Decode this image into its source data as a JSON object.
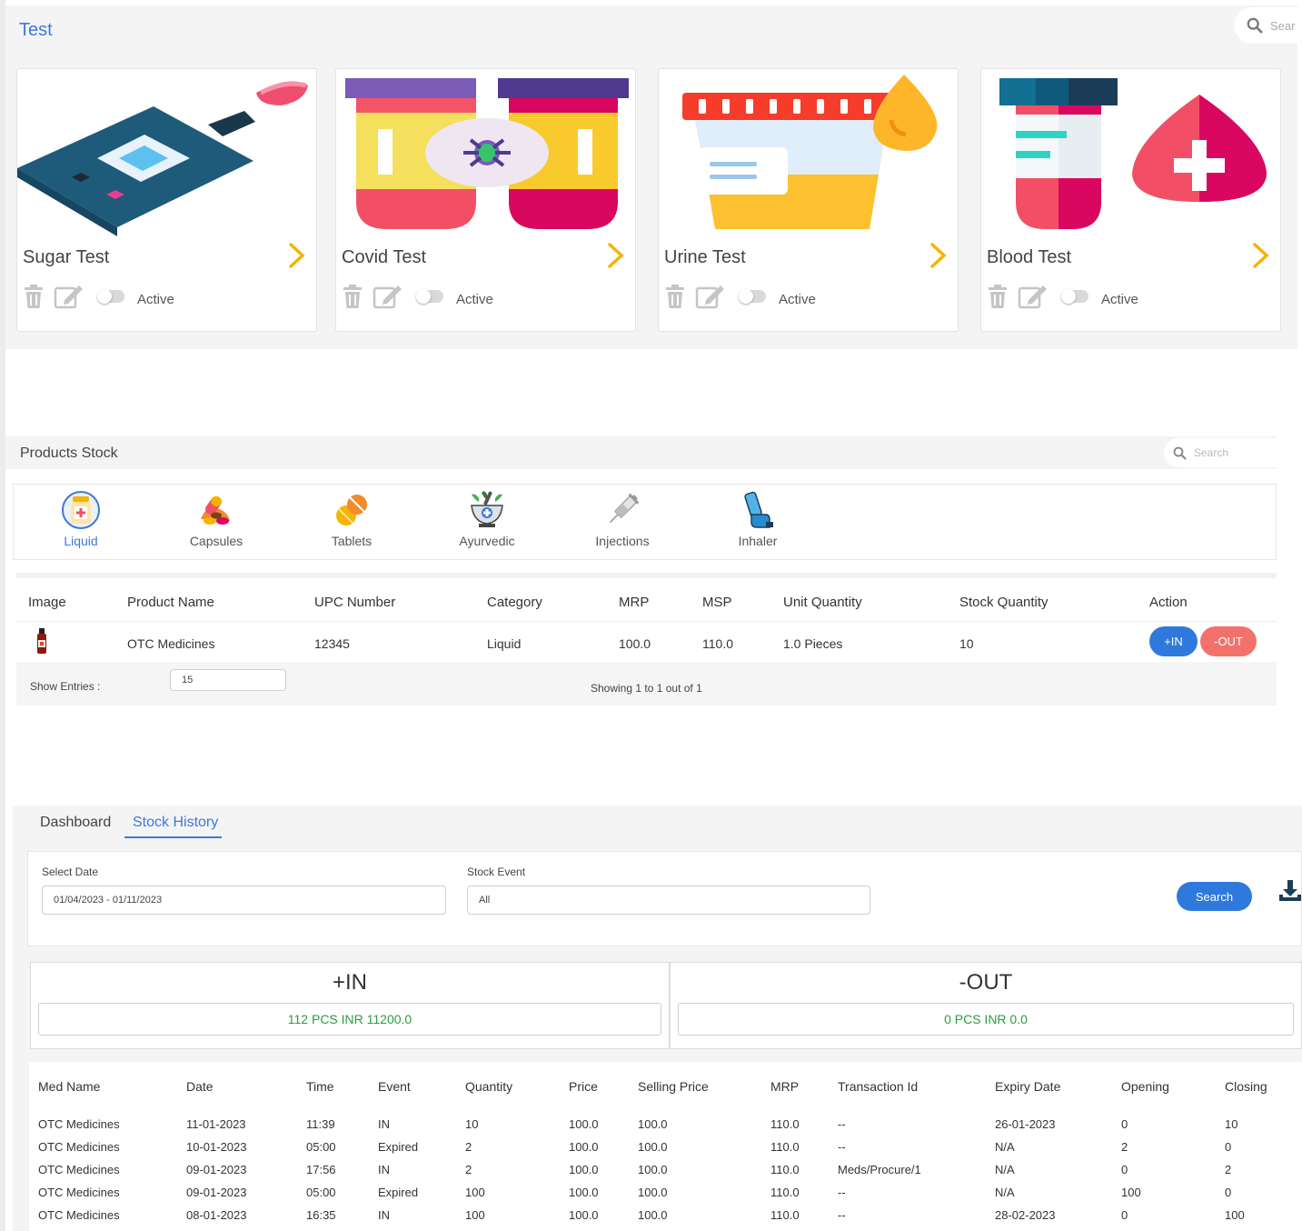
{
  "test_section": {
    "title": "Test",
    "search_placeholder": "Sear",
    "cards": [
      {
        "name": "Sugar Test",
        "status": "Active",
        "icon": "glucose-meter-icon"
      },
      {
        "name": "Covid Test",
        "status": "Active",
        "icon": "covid-test-icon"
      },
      {
        "name": "Urine Test",
        "status": "Active",
        "icon": "urine-sample-icon"
      },
      {
        "name": "Blood Test",
        "status": "Active",
        "icon": "blood-sample-icon"
      }
    ]
  },
  "products_stock": {
    "title": "Products Stock",
    "search_placeholder": "Search",
    "categories": [
      {
        "label": "Liquid",
        "icon": "liquid-bottle-icon",
        "selected": true
      },
      {
        "label": "Capsules",
        "icon": "capsules-icon",
        "selected": false
      },
      {
        "label": "Tablets",
        "icon": "tablets-icon",
        "selected": false
      },
      {
        "label": "Ayurvedic",
        "icon": "ayurvedic-mortar-icon",
        "selected": false
      },
      {
        "label": "Injections",
        "icon": "syringe-icon",
        "selected": false
      },
      {
        "label": "Inhaler",
        "icon": "inhaler-icon",
        "selected": false
      }
    ],
    "table": {
      "headers": [
        "Image",
        "Product Name",
        "UPC Number",
        "Category",
        "MRP",
        "MSP",
        "Unit Quantity",
        "Stock Quantity",
        "Action"
      ],
      "row": {
        "product_name": "OTC Medicines",
        "upc": "12345",
        "category": "Liquid",
        "mrp": "100.0",
        "msp": "110.0",
        "unit_qty": "1.0 Pieces",
        "stock_qty": "10"
      },
      "in_label": "+IN",
      "out_label": "-OUT"
    },
    "show_entries_label": "Show Entries :",
    "entries_value": "15",
    "showing_text": "Showing 1 to 1 out of 1"
  },
  "stock_history": {
    "tabs": [
      {
        "label": "Dashboard",
        "selected": false
      },
      {
        "label": "Stock History",
        "selected": true
      }
    ],
    "select_date_label": "Select Date",
    "select_date_value": "01/04/2023 - 01/11/2023",
    "stock_event_label": "Stock Event",
    "stock_event_value": "All",
    "search_label": "Search",
    "in_title": "+IN",
    "in_value": "112 PCS INR 11200.0",
    "out_title": "-OUT",
    "out_value": "0 PCS INR 0.0",
    "headers": [
      "Med Name",
      "Date",
      "Time",
      "Event",
      "Quantity",
      "Price",
      "Selling Price",
      "MRP",
      "Transaction Id",
      "Expiry Date",
      "Opening",
      "Closing"
    ],
    "rows": [
      [
        "OTC Medicines",
        "11-01-2023",
        "11:39",
        "IN",
        "10",
        "100.0",
        "100.0",
        "110.0",
        "--",
        "26-01-2023",
        "0",
        "10"
      ],
      [
        "OTC Medicines",
        "10-01-2023",
        "05:00",
        "Expired",
        "2",
        "100.0",
        "100.0",
        "110.0",
        "--",
        "N/A",
        "2",
        "0"
      ],
      [
        "OTC Medicines",
        "09-01-2023",
        "17:56",
        "IN",
        "2",
        "100.0",
        "100.0",
        "110.0",
        "Meds/Procure/1",
        "N/A",
        "0",
        "2"
      ],
      [
        "OTC Medicines",
        "09-01-2023",
        "05:00",
        "Expired",
        "100",
        "100.0",
        "100.0",
        "110.0",
        "--",
        "N/A",
        "100",
        "0"
      ],
      [
        "OTC Medicines",
        "08-01-2023",
        "16:35",
        "IN",
        "100",
        "100.0",
        "100.0",
        "110.0",
        "--",
        "28-02-2023",
        "0",
        "100"
      ]
    ]
  },
  "colors": {
    "accent": "#3f78d9",
    "in_button": "#2f79dd",
    "out_button": "#f2726b",
    "chevron": "#f5b400",
    "summary_value": "#2a9d3a"
  }
}
